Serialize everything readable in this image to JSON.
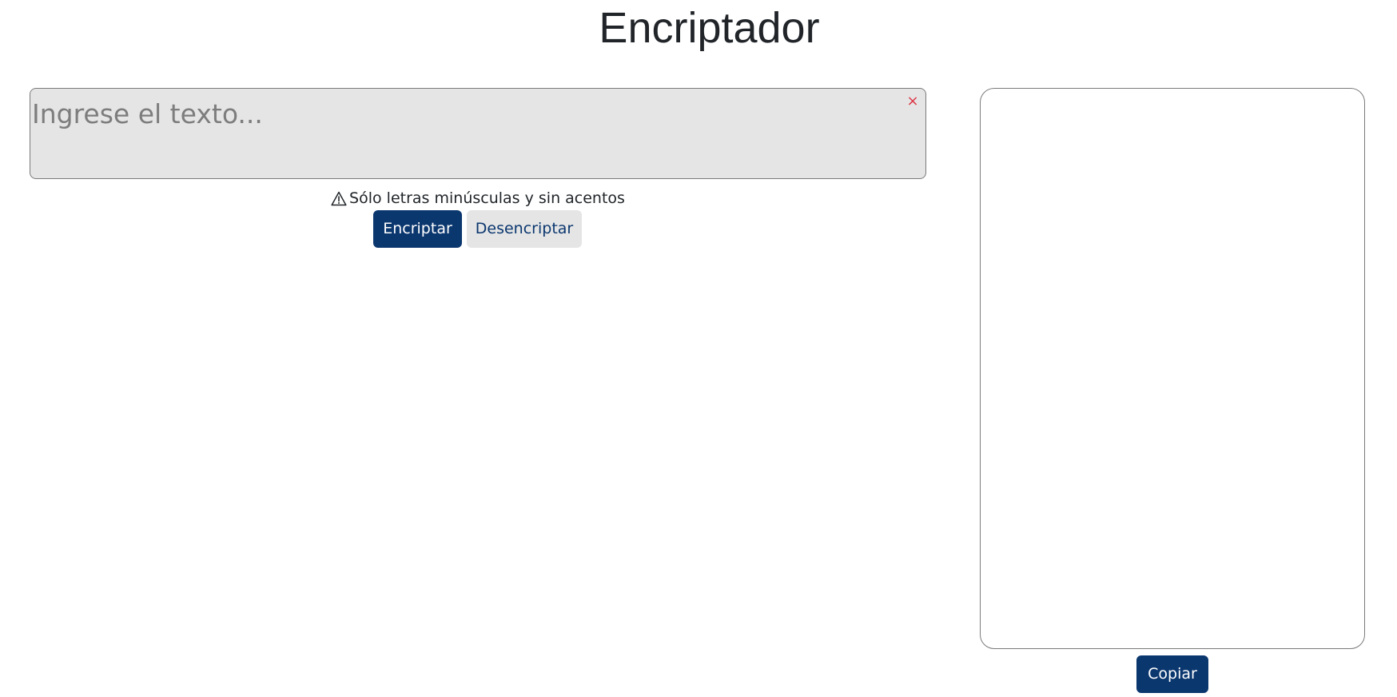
{
  "header": {
    "title": "Encriptador"
  },
  "input": {
    "placeholder": "Ingrese el texto...",
    "value": "",
    "clear_symbol": "×",
    "clear_color": "#dc3545"
  },
  "hint": {
    "icon": "warning-triangle-icon",
    "text": "Sólo letras minúsculas y sin acentos"
  },
  "actions": {
    "encrypt_label": "Encriptar",
    "decrypt_label": "Desencriptar",
    "primary_color": "#0b376f",
    "secondary_bg": "#e5e5e5"
  },
  "output": {
    "value": "",
    "copy_label": "Copiar"
  }
}
